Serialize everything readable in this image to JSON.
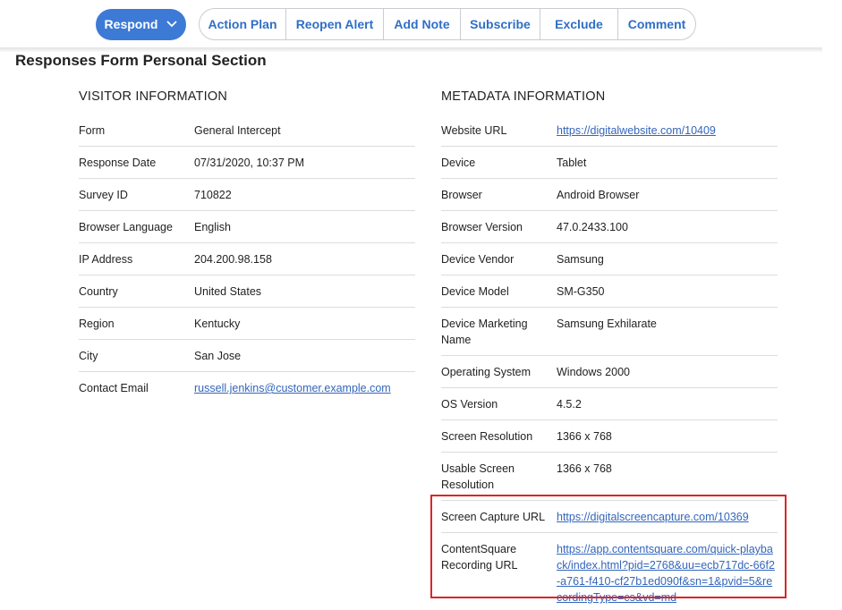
{
  "toolbar": {
    "respond_label": "Respond",
    "buttons": [
      {
        "label": "Action Plan"
      },
      {
        "label": "Reopen Alert"
      },
      {
        "label": "Add Note"
      },
      {
        "label": "Subscribe"
      },
      {
        "label": "Exclude"
      },
      {
        "label": "Comment"
      }
    ]
  },
  "section_title": "Responses Form Personal Section",
  "visitor": {
    "title": "VISITOR INFORMATION",
    "rows": [
      {
        "label": "Form",
        "value": "General Intercept"
      },
      {
        "label": "Response Date",
        "value": "07/31/2020, 10:37 PM"
      },
      {
        "label": "Survey ID",
        "value": "710822"
      },
      {
        "label": "Browser Language",
        "value": "English"
      },
      {
        "label": "IP Address",
        "value": "204.200.98.158"
      },
      {
        "label": "Country",
        "value": "United States"
      },
      {
        "label": "Region",
        "value": "Kentucky"
      },
      {
        "label": "City",
        "value": "San Jose"
      },
      {
        "label": "Contact Email",
        "value": "russell.jenkins@customer.example.com"
      }
    ]
  },
  "metadata": {
    "title": "METADATA INFORMATION",
    "rows": [
      {
        "label": "Website URL",
        "value": "https://digitalwebsite.com/10409"
      },
      {
        "label": "Device",
        "value": "Tablet"
      },
      {
        "label": "Browser",
        "value": "Android Browser"
      },
      {
        "label": "Browser Version",
        "value": "47.0.2433.100"
      },
      {
        "label": "Device Vendor",
        "value": "Samsung"
      },
      {
        "label": "Device Model",
        "value": "SM-G350"
      },
      {
        "label": "Device Marketing Name",
        "value": "Samsung Exhilarate"
      },
      {
        "label": "Operating System",
        "value": "Windows 2000"
      },
      {
        "label": "OS Version",
        "value": "4.5.2"
      },
      {
        "label": "Screen Resolution",
        "value": "1366 x 768"
      },
      {
        "label": "Usable Screen Resolution",
        "value": "1366 x 768"
      },
      {
        "label": "Screen Capture URL",
        "value": "https://digitalscreencapture.com/10369"
      },
      {
        "label": "ContentSquare Recording URL",
        "value": "https://app.contentsquare.com/quick-playback/index.html?pid=2768&uu=ecb717dc-66f2-a761-f410-cf27b1ed090f&sn=1&pvid=5&recordingType=cs&vd=md"
      }
    ]
  },
  "colors": {
    "primary": "#3d7ad6",
    "link": "#3366bb",
    "highlight_border": "#d9262a"
  },
  "icons": {
    "respond_dropdown": "chevron-down-icon"
  }
}
